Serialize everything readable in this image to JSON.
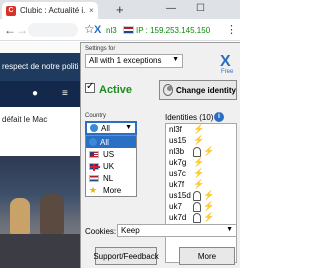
{
  "browser": {
    "tab_title": "Clubic : Actualité i...",
    "favicon_letter": "C",
    "tab_close": "×",
    "new_tab": "+",
    "win_min": "—",
    "win_max": "☐",
    "nav_back": "←",
    "nav_forward": "→",
    "bookmark_star": "☆",
    "menu": "⋮"
  },
  "extension_badge": {
    "logo": "X",
    "location": "nl3",
    "ip_text": "IP : 159.253.145.150"
  },
  "page": {
    "nav_text": "respect de notre politi",
    "headline": "défait le Mac",
    "search_glyph": "⌕",
    "user_glyph": "●",
    "menu_glyph": "≡"
  },
  "popup": {
    "settings_label": "Settings for",
    "settings_value": "All with 1 exceptions",
    "brand_logo": "X",
    "brand_free": "Free",
    "active_label": "Active",
    "active_checked": true,
    "change_identity_label": "Change identity",
    "country_label": "Country",
    "country_selected": "All",
    "country_options": [
      "All",
      "US",
      "UK",
      "NL",
      "More"
    ],
    "identities_label": "Identities (10)",
    "info_glyph": "i",
    "identities": [
      {
        "name": "nl3f",
        "icons": [
          "bolt"
        ]
      },
      {
        "name": "us15",
        "icons": [
          "bolt"
        ]
      },
      {
        "name": "nl3b",
        "icons": [
          "ghost",
          "bolt"
        ]
      },
      {
        "name": "uk7g",
        "icons": [
          "bolt"
        ]
      },
      {
        "name": "us7c",
        "icons": [
          "bolt"
        ]
      },
      {
        "name": "uk7f",
        "icons": [
          "bolt"
        ]
      },
      {
        "name": "us15d",
        "icons": [
          "ghost",
          "bolt"
        ]
      },
      {
        "name": "uk7",
        "icons": [
          "ghost",
          "bolt"
        ]
      },
      {
        "name": "uk7d",
        "icons": [
          "ghost",
          "bolt"
        ]
      }
    ],
    "cookies_label": "Cookies:",
    "cookies_value": "Keep",
    "support_button": "Support/Feedback",
    "more_button": "More",
    "caret": "▼"
  }
}
